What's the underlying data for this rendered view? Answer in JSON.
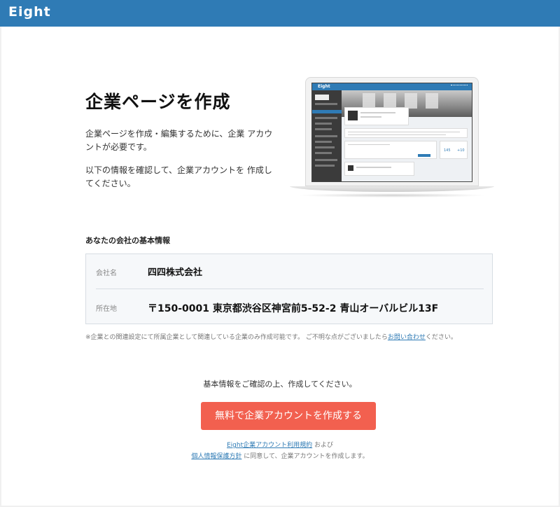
{
  "header": {
    "logo_text": "Eight",
    "bar_color": "#2f7bb5"
  },
  "hero": {
    "title": "企業ページを作成",
    "description_1": "企業ページを作成・編集するために、企業 アカウントが必要です。",
    "description_2": "以下の情報を確認して、企業アカウントを 作成してください。"
  },
  "illustration": {
    "screen_logo": "Eight",
    "stat_1": "145",
    "stat_2": "+10"
  },
  "company_info": {
    "section_title": "あなたの会社の基本情報",
    "rows": [
      {
        "label": "会社名",
        "value": "四四株式会社"
      },
      {
        "label": "所在地",
        "value": "〒150-0001 東京都渋谷区神宮前5-52-2 青山オーバルビル13F"
      }
    ]
  },
  "note": {
    "text": "※企業との関連設定にて所属企業として関連している企業のみ作成可能です。 ご不明な点がございましたら",
    "link": "お問い合わせ",
    "suffix": "ください。"
  },
  "confirm_text": "基本情報をご確認の上、作成してください。",
  "cta": {
    "label": "無料で企業アカウントを作成する",
    "color": "#f2604f"
  },
  "terms": {
    "terms_link": "Eight企業アカウント利用規約",
    "and_text": " および",
    "privacy_link": "個人情報保護方針",
    "agree_text": " に同意して、企業アカウントを作成します。"
  }
}
